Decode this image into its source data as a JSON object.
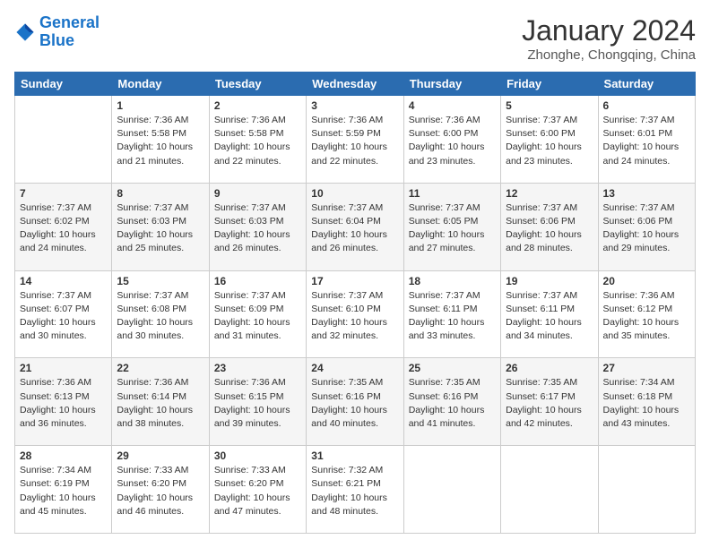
{
  "header": {
    "logo_line1": "General",
    "logo_line2": "Blue",
    "month": "January 2024",
    "location": "Zhonghe, Chongqing, China"
  },
  "weekdays": [
    "Sunday",
    "Monday",
    "Tuesday",
    "Wednesday",
    "Thursday",
    "Friday",
    "Saturday"
  ],
  "weeks": [
    [
      {
        "day": "",
        "info": ""
      },
      {
        "day": "1",
        "info": "Sunrise: 7:36 AM\nSunset: 5:58 PM\nDaylight: 10 hours\nand 21 minutes."
      },
      {
        "day": "2",
        "info": "Sunrise: 7:36 AM\nSunset: 5:58 PM\nDaylight: 10 hours\nand 22 minutes."
      },
      {
        "day": "3",
        "info": "Sunrise: 7:36 AM\nSunset: 5:59 PM\nDaylight: 10 hours\nand 22 minutes."
      },
      {
        "day": "4",
        "info": "Sunrise: 7:36 AM\nSunset: 6:00 PM\nDaylight: 10 hours\nand 23 minutes."
      },
      {
        "day": "5",
        "info": "Sunrise: 7:37 AM\nSunset: 6:00 PM\nDaylight: 10 hours\nand 23 minutes."
      },
      {
        "day": "6",
        "info": "Sunrise: 7:37 AM\nSunset: 6:01 PM\nDaylight: 10 hours\nand 24 minutes."
      }
    ],
    [
      {
        "day": "7",
        "info": "Sunrise: 7:37 AM\nSunset: 6:02 PM\nDaylight: 10 hours\nand 24 minutes."
      },
      {
        "day": "8",
        "info": "Sunrise: 7:37 AM\nSunset: 6:03 PM\nDaylight: 10 hours\nand 25 minutes."
      },
      {
        "day": "9",
        "info": "Sunrise: 7:37 AM\nSunset: 6:03 PM\nDaylight: 10 hours\nand 26 minutes."
      },
      {
        "day": "10",
        "info": "Sunrise: 7:37 AM\nSunset: 6:04 PM\nDaylight: 10 hours\nand 26 minutes."
      },
      {
        "day": "11",
        "info": "Sunrise: 7:37 AM\nSunset: 6:05 PM\nDaylight: 10 hours\nand 27 minutes."
      },
      {
        "day": "12",
        "info": "Sunrise: 7:37 AM\nSunset: 6:06 PM\nDaylight: 10 hours\nand 28 minutes."
      },
      {
        "day": "13",
        "info": "Sunrise: 7:37 AM\nSunset: 6:06 PM\nDaylight: 10 hours\nand 29 minutes."
      }
    ],
    [
      {
        "day": "14",
        "info": "Sunrise: 7:37 AM\nSunset: 6:07 PM\nDaylight: 10 hours\nand 30 minutes."
      },
      {
        "day": "15",
        "info": "Sunrise: 7:37 AM\nSunset: 6:08 PM\nDaylight: 10 hours\nand 30 minutes."
      },
      {
        "day": "16",
        "info": "Sunrise: 7:37 AM\nSunset: 6:09 PM\nDaylight: 10 hours\nand 31 minutes."
      },
      {
        "day": "17",
        "info": "Sunrise: 7:37 AM\nSunset: 6:10 PM\nDaylight: 10 hours\nand 32 minutes."
      },
      {
        "day": "18",
        "info": "Sunrise: 7:37 AM\nSunset: 6:11 PM\nDaylight: 10 hours\nand 33 minutes."
      },
      {
        "day": "19",
        "info": "Sunrise: 7:37 AM\nSunset: 6:11 PM\nDaylight: 10 hours\nand 34 minutes."
      },
      {
        "day": "20",
        "info": "Sunrise: 7:36 AM\nSunset: 6:12 PM\nDaylight: 10 hours\nand 35 minutes."
      }
    ],
    [
      {
        "day": "21",
        "info": "Sunrise: 7:36 AM\nSunset: 6:13 PM\nDaylight: 10 hours\nand 36 minutes."
      },
      {
        "day": "22",
        "info": "Sunrise: 7:36 AM\nSunset: 6:14 PM\nDaylight: 10 hours\nand 38 minutes."
      },
      {
        "day": "23",
        "info": "Sunrise: 7:36 AM\nSunset: 6:15 PM\nDaylight: 10 hours\nand 39 minutes."
      },
      {
        "day": "24",
        "info": "Sunrise: 7:35 AM\nSunset: 6:16 PM\nDaylight: 10 hours\nand 40 minutes."
      },
      {
        "day": "25",
        "info": "Sunrise: 7:35 AM\nSunset: 6:16 PM\nDaylight: 10 hours\nand 41 minutes."
      },
      {
        "day": "26",
        "info": "Sunrise: 7:35 AM\nSunset: 6:17 PM\nDaylight: 10 hours\nand 42 minutes."
      },
      {
        "day": "27",
        "info": "Sunrise: 7:34 AM\nSunset: 6:18 PM\nDaylight: 10 hours\nand 43 minutes."
      }
    ],
    [
      {
        "day": "28",
        "info": "Sunrise: 7:34 AM\nSunset: 6:19 PM\nDaylight: 10 hours\nand 45 minutes."
      },
      {
        "day": "29",
        "info": "Sunrise: 7:33 AM\nSunset: 6:20 PM\nDaylight: 10 hours\nand 46 minutes."
      },
      {
        "day": "30",
        "info": "Sunrise: 7:33 AM\nSunset: 6:20 PM\nDaylight: 10 hours\nand 47 minutes."
      },
      {
        "day": "31",
        "info": "Sunrise: 7:32 AM\nSunset: 6:21 PM\nDaylight: 10 hours\nand 48 minutes."
      },
      {
        "day": "",
        "info": ""
      },
      {
        "day": "",
        "info": ""
      },
      {
        "day": "",
        "info": ""
      }
    ]
  ]
}
